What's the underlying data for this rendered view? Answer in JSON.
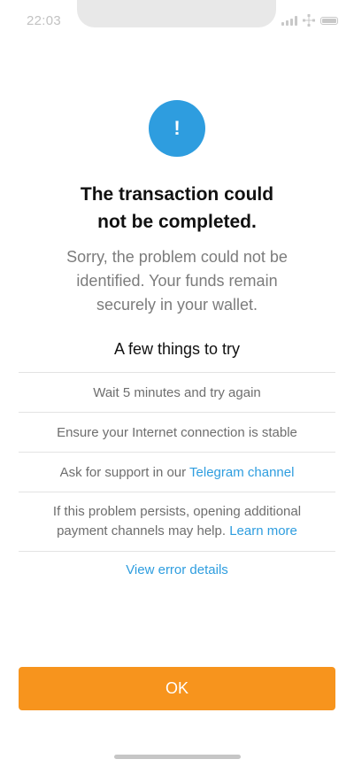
{
  "status_bar": {
    "time": "22:03",
    "icons": [
      "signal-icon",
      "network-icon",
      "battery-icon"
    ]
  },
  "alert": {
    "icon": "exclamation-icon",
    "glyph": "!",
    "color": "#2e9ddf"
  },
  "title": {
    "line1": "The transaction could",
    "line2": "not be completed."
  },
  "subtitle": {
    "line1": "Sorry, the problem could not be",
    "line2": "identified. Your funds remain",
    "line3": "securely in your wallet."
  },
  "tips": {
    "heading": "A few things to try",
    "items": [
      {
        "text": "Wait 5 minutes and try again"
      },
      {
        "text": "Ensure your Internet connection is stable"
      },
      {
        "text": "Ask for support in our ",
        "link": "Telegram channel"
      },
      {
        "line1": "If this problem persists, opening additional",
        "line2": "payment channels may help. ",
        "link": "Learn more"
      }
    ]
  },
  "view_error_label": "View error details",
  "ok_button": {
    "label": "OK",
    "color": "#f7941d"
  },
  "link_color": "#2e9ddf"
}
